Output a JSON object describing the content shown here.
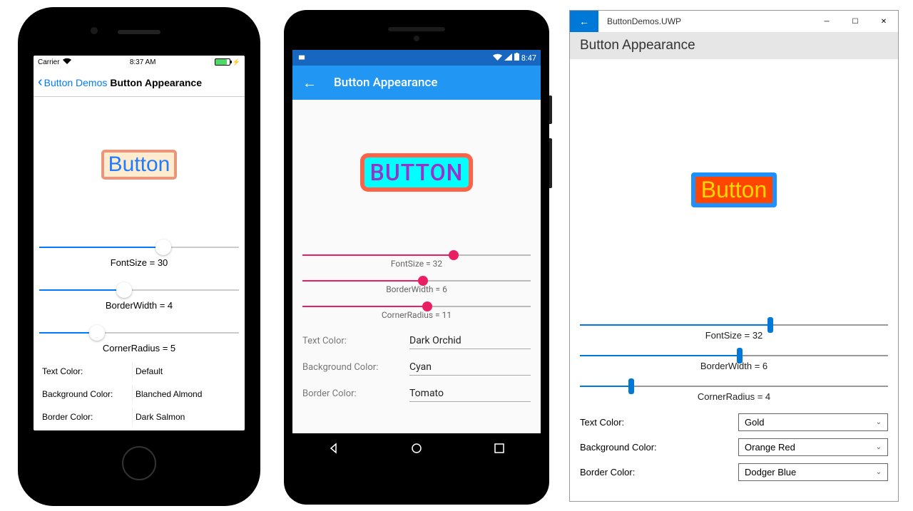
{
  "ios": {
    "carrier": "Carrier",
    "time": "8:37 AM",
    "back_label": "Button Demos",
    "title": "Button Appearance",
    "demo_button": "Button",
    "fontsize_label": "FontSize = 30",
    "borderwidth_label": "BorderWidth = 4",
    "cornerradius_label": "CornerRadius = 5",
    "slider_fontsize_pct": 63,
    "slider_borderwidth_pct": 42,
    "slider_cornerradius_pct": 27,
    "textcolor_label": "Text Color:",
    "bgcolor_label": "Background Color:",
    "bordercolor_label": "Border Color:",
    "textcolor_value": "Default",
    "bgcolor_value": "Blanched Almond",
    "bordercolor_value": "Dark Salmon"
  },
  "android": {
    "time": "8:47",
    "title": "Button Appearance",
    "demo_button": "BUTTON",
    "fontsize_label": "FontSize = 32",
    "borderwidth_label": "BorderWidth = 6",
    "cornerradius_label": "CornerRadius = 11",
    "slider_fontsize_pct": 67,
    "slider_borderwidth_pct": 53,
    "slider_cornerradius_pct": 55,
    "textcolor_label": "Text Color:",
    "bgcolor_label": "Background Color:",
    "bordercolor_label": "Border Color:",
    "textcolor_value": "Dark Orchid",
    "bgcolor_value": "Cyan",
    "bordercolor_value": "Tomato"
  },
  "uwp": {
    "window_title": "ButtonDemos.UWP",
    "header": "Button Appearance",
    "demo_button": "Button",
    "fontsize_label": "FontSize = 32",
    "borderwidth_label": "BorderWidth = 6",
    "cornerradius_label": "CornerRadius = 4",
    "slider_fontsize_pct": 62,
    "slider_borderwidth_pct": 52,
    "slider_cornerradius_pct": 16,
    "textcolor_label": "Text Color:",
    "bgcolor_label": "Background Color:",
    "bordercolor_label": "Border Color:",
    "textcolor_value": "Gold",
    "bgcolor_value": "Orange Red",
    "bordercolor_value": "Dodger Blue"
  }
}
